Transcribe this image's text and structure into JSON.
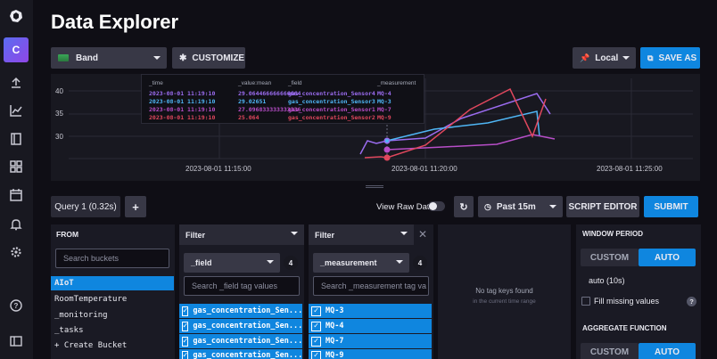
{
  "page": {
    "title": "Data Explorer"
  },
  "nav": {
    "org_initial": "C"
  },
  "toolbar": {
    "graph_type": "Band",
    "customize": "CUSTOMIZE",
    "timezone": "Local",
    "save_as": "SAVE AS"
  },
  "graph": {
    "y_ticks": [
      "40",
      "35",
      "30"
    ],
    "x_ticks": [
      "2023-08-01 11:15:00",
      "2023-08-01 11:20:00",
      "2023-08-01 11:25:00"
    ]
  },
  "tooltip": {
    "headers": [
      "_time",
      "_value:mean",
      "_field",
      "_measurement"
    ],
    "rows": [
      {
        "time": "2023-08-01 11:19:10",
        "value": "29.064466666666664",
        "field": "gas_concentration_Sensor4",
        "measurement": "MQ-4",
        "color": "#9b6cf0"
      },
      {
        "time": "2023-08-01 11:19:10",
        "value": "29.02651",
        "field": "gas_concentration_Sensor3",
        "measurement": "MQ-3",
        "color": "#4fb6f5"
      },
      {
        "time": "2023-08-01 11:19:10",
        "value": "27.096833333333336",
        "field": "gas_concentration_Sensor1",
        "measurement": "MQ-7",
        "color": "#b84ec8"
      },
      {
        "time": "2023-08-01 11:19:10",
        "value": "25.064",
        "field": "gas_concentration_Sensor2",
        "measurement": "MQ-9",
        "color": "#e0475d"
      }
    ]
  },
  "query": {
    "tab_label": "Query 1 (0.32s)",
    "add_label": "+",
    "raw_data_label": "View Raw Data",
    "time_range": "Past 15m",
    "script_editor": "SCRIPT EDITOR",
    "submit": "SUBMIT"
  },
  "from": {
    "heading": "FROM",
    "search_placeholder": "Search buckets",
    "buckets": [
      "AIoT",
      "RoomTemperature",
      "_monitoring",
      "_tasks",
      "+ Create Bucket"
    ]
  },
  "filter1": {
    "label": "Filter",
    "key": "_field",
    "count": "4",
    "search_placeholder": "Search _field tag values",
    "values": [
      "gas_concentration_Sen...",
      "gas_concentration_Sen...",
      "gas_concentration_Sen...",
      "gas_concentration_Sen..."
    ]
  },
  "filter2": {
    "label": "Filter",
    "key": "_measurement",
    "count": "4",
    "search_placeholder": "Search _measurement tag va",
    "values": [
      "MQ-3",
      "MQ-4",
      "MQ-7",
      "MQ-9"
    ]
  },
  "filter3": {
    "empty_title": "No tag keys found",
    "empty_sub": "in the current time range"
  },
  "window": {
    "heading": "WINDOW PERIOD",
    "custom": "CUSTOM",
    "auto": "AUTO",
    "auto_value": "auto (10s)",
    "fill_missing": "Fill missing values",
    "help": "?",
    "aggregate_heading": "AGGREGATE FUNCTION",
    "custom2": "CUSTOM",
    "auto2": "AUTO"
  }
}
